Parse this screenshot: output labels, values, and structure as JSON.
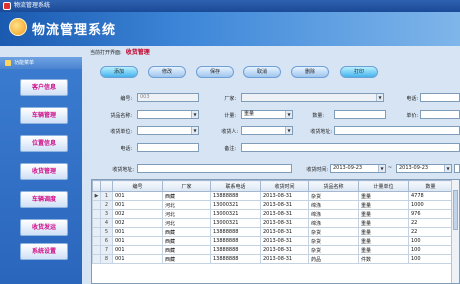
{
  "window": {
    "title": "物流管理系统"
  },
  "banner": {
    "title": "物流管理系统"
  },
  "nav": {
    "header": "功能菜单",
    "items": [
      "客户信息",
      "车辆管理",
      "位置信息",
      "收货管理",
      "车辆调度",
      "收货发运",
      "系统设置"
    ]
  },
  "breadcrumb": {
    "prefix": "当前打开界面:",
    "current": "收货管理"
  },
  "toolbar": {
    "buttons": [
      "添加",
      "修改",
      "保存",
      "取消",
      "删除",
      "打印"
    ]
  },
  "form": {
    "id_label": "编号:",
    "id_value": "003",
    "factory_label": "厂家:",
    "factory_value": "",
    "phone_label": "电话:",
    "phone_value": "",
    "goods_label": "货品名称:",
    "goods_value": "",
    "unit_label": "计量:",
    "unit_value": "重量",
    "qty_label": "数量:",
    "qty_value": "",
    "price_label": "单价:",
    "price_value": "",
    "recv_unit_label": "收货单位:",
    "recv_unit_value": "",
    "receiver_label": "收货人:",
    "receiver_value": "",
    "recv_addr_label": "收货地址:",
    "recv_addr_value": "",
    "tel_label": "电话:",
    "tel_value": "",
    "note_label": "备注:",
    "note_value": "",
    "ship_addr_label": "收货地址:",
    "ship_addr_value": "",
    "recv_time_label": "收货时间:",
    "date_from": "2013-09-23",
    "date_sep": "~",
    "date_to": "2013-09-23"
  },
  "grid": {
    "columns": [
      "编号",
      "厂家",
      "联系电话",
      "收货时间",
      "货品名称",
      "计量单位",
      "数量"
    ],
    "rows": [
      [
        "001",
        "西藏",
        "13888888",
        "2013-08-31",
        "杂货",
        "重量",
        "4778"
      ],
      [
        "001",
        "河北",
        "13000321",
        "2013-08-31",
        "绵涤",
        "重量",
        "1000"
      ],
      [
        "002",
        "河北",
        "13000321",
        "2013-08-31",
        "绵涤",
        "重量",
        "976"
      ],
      [
        "002",
        "河北",
        "13000321",
        "2013-08-31",
        "绵涤",
        "重量",
        "22"
      ],
      [
        "001",
        "西藏",
        "13888888",
        "2013-08-31",
        "杂货",
        "重量",
        "22"
      ],
      [
        "001",
        "西藏",
        "13888888",
        "2013-08-31",
        "杂货",
        "重量",
        "100"
      ],
      [
        "001",
        "西藏",
        "13888888",
        "2013-08-31",
        "杂货",
        "重量",
        "100"
      ],
      [
        "001",
        "西藏",
        "13888888",
        "2013-08-31",
        "药品",
        "件数",
        "100"
      ]
    ],
    "row_numbers": [
      "1",
      "2",
      "3",
      "4",
      "5",
      "6",
      "7",
      "8"
    ]
  }
}
